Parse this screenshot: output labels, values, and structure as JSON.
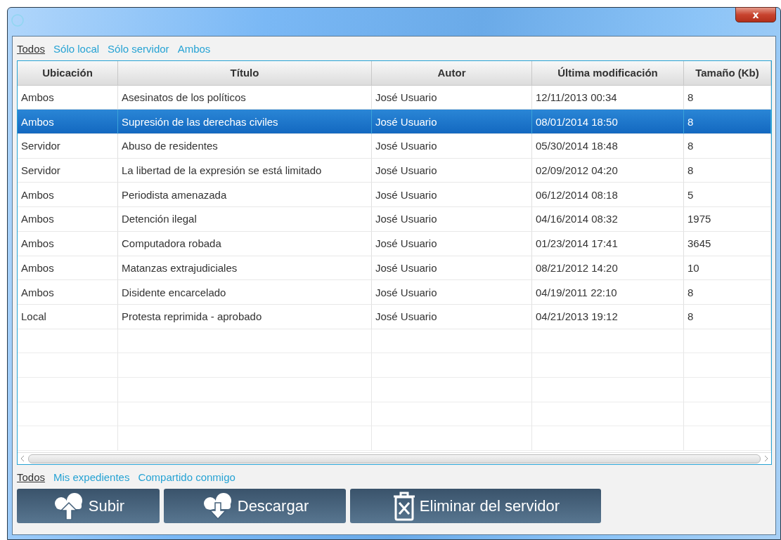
{
  "window": {
    "close_label": "x"
  },
  "location_filters": [
    {
      "label": "Todos",
      "selected": true
    },
    {
      "label": "Sólo local",
      "selected": false
    },
    {
      "label": "Sólo servidor",
      "selected": false
    },
    {
      "label": "Ambos",
      "selected": false
    }
  ],
  "table": {
    "columns": [
      "Ubicación",
      "Título",
      "Autor",
      "Última modificación",
      "Tamaño (Kb)"
    ],
    "rows": [
      {
        "cells": [
          "Ambos",
          "Asesinatos de los políticos",
          "José Usuario",
          "12/11/2013 00:34",
          "8"
        ],
        "selected": false
      },
      {
        "cells": [
          "Ambos",
          "Supresión de las derechas civiles",
          "José Usuario",
          "08/01/2014 18:50",
          "8"
        ],
        "selected": true
      },
      {
        "cells": [
          "Servidor",
          "Abuso de residentes",
          "José Usuario",
          "05/30/2014 18:48",
          "8"
        ],
        "selected": false
      },
      {
        "cells": [
          "Servidor",
          "La libertad de la expresión se está limitado",
          "José Usuario",
          "02/09/2012 04:20",
          "8"
        ],
        "selected": false
      },
      {
        "cells": [
          "Ambos",
          "Periodista amenazada",
          "José Usuario",
          "06/12/2014 08:18",
          "5"
        ],
        "selected": false
      },
      {
        "cells": [
          "Ambos",
          "Detención ilegal",
          "José Usuario",
          "04/16/2014 08:32",
          "1975"
        ],
        "selected": false
      },
      {
        "cells": [
          "Ambos",
          "Computadora robada",
          "José Usuario",
          "01/23/2014 17:41",
          "3645"
        ],
        "selected": false
      },
      {
        "cells": [
          "Ambos",
          "Matanzas extrajudiciales",
          "José Usuario",
          "08/21/2012 14:20",
          "10"
        ],
        "selected": false
      },
      {
        "cells": [
          "Ambos",
          "Disidente encarcelado",
          "José Usuario",
          "04/19/2011 22:10",
          "8"
        ],
        "selected": false
      },
      {
        "cells": [
          "Local",
          "Protesta reprimida - aprobado",
          "José Usuario",
          "04/21/2013 19:12",
          "8"
        ],
        "selected": false
      }
    ]
  },
  "owner_filters": [
    {
      "label": "Todos",
      "selected": true
    },
    {
      "label": "Mis expedientes",
      "selected": false
    },
    {
      "label": "Compartido conmigo",
      "selected": false
    }
  ],
  "buttons": [
    {
      "kind": "upload",
      "label": "Subir"
    },
    {
      "kind": "download",
      "label": "Descargar"
    },
    {
      "kind": "delete",
      "label": "Eliminar del servidor"
    }
  ]
}
